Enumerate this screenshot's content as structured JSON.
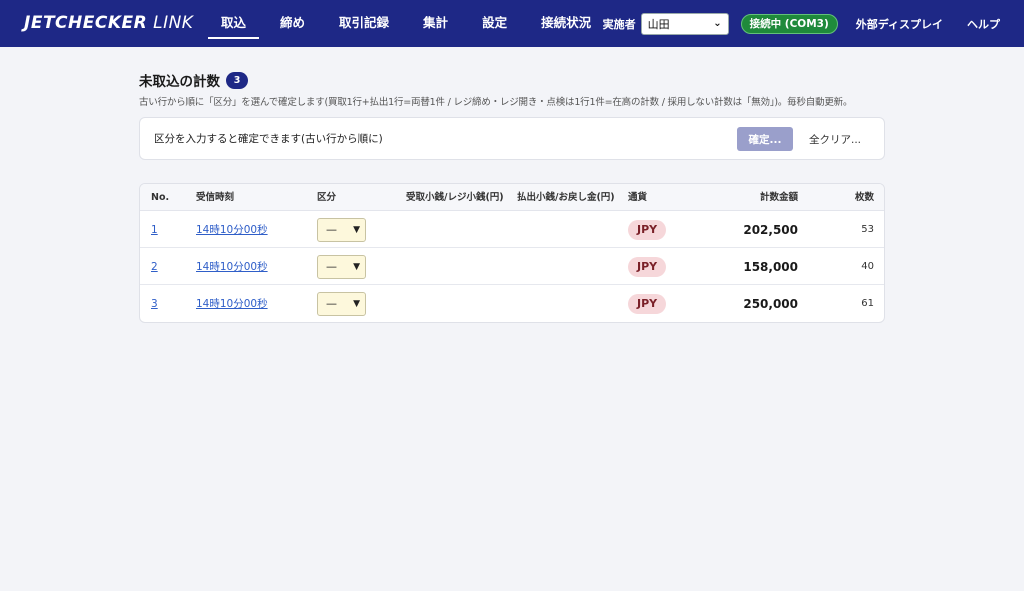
{
  "header": {
    "brand_bold": "JETCHECKER",
    "brand_light": "LINK",
    "nav": [
      {
        "label": "取込",
        "active": true
      },
      {
        "label": "締め",
        "active": false
      },
      {
        "label": "取引記録",
        "active": false
      },
      {
        "label": "集計",
        "active": false
      },
      {
        "label": "設定",
        "active": false
      },
      {
        "label": "接続状況",
        "active": false
      }
    ],
    "operator_label": "実施者",
    "operator_value": "山田",
    "connection_status": "接続中 (COM3)",
    "external_display": "外部ディスプレイ",
    "help": "ヘルプ"
  },
  "page": {
    "title": "未取込の計数",
    "count": "3",
    "subtitle": "古い行から順に「区分」を選んで確定します(買取1行+払出1行=両替1件 / レジ締め・レジ開き・点検は1行1件=在高の計数 / 採用しない計数は「無効」)。毎秒自動更新。"
  },
  "actions": {
    "hint": "区分を入力すると確定できます(古い行から順に)",
    "confirm_label": "確定...",
    "clear_label": "全クリア..."
  },
  "table": {
    "columns": [
      "No.",
      "受信時刻",
      "区分",
      "受取小銭/レジ小銭(円)",
      "払出小銭/お戻し金(円)",
      "通貨",
      "計数金額",
      "枚数"
    ],
    "rows": [
      {
        "no": "1",
        "time": "14時10分00秒",
        "category": "—",
        "received": "",
        "paid": "",
        "currency": "JPY",
        "amount": "202,500",
        "pieces": "53"
      },
      {
        "no": "2",
        "time": "14時10分00秒",
        "category": "—",
        "received": "",
        "paid": "",
        "currency": "JPY",
        "amount": "158,000",
        "pieces": "40"
      },
      {
        "no": "3",
        "time": "14時10分00秒",
        "category": "—",
        "received": "",
        "paid": "",
        "currency": "JPY",
        "amount": "250,000",
        "pieces": "61"
      }
    ]
  },
  "colors": {
    "header_bg": "#1e2886",
    "connected_green": "#1f8a3b",
    "currency_badge_bg": "#f6d7da",
    "confirm_disabled": "#9a9fcb",
    "select_bg": "#fdf8dc"
  },
  "icons": {
    "dropdown": "chevron-down-icon"
  }
}
